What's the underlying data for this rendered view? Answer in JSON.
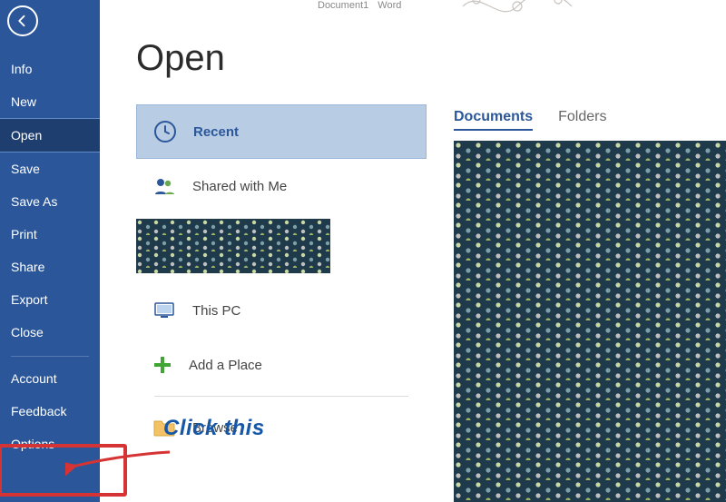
{
  "sidebar": {
    "items": [
      {
        "label": "Info"
      },
      {
        "label": "New"
      },
      {
        "label": "Open"
      },
      {
        "label": "Save"
      },
      {
        "label": "Save As"
      },
      {
        "label": "Print"
      },
      {
        "label": "Share"
      },
      {
        "label": "Export"
      },
      {
        "label": "Close"
      }
    ],
    "footer": [
      {
        "label": "Account"
      },
      {
        "label": "Feedback"
      },
      {
        "label": "Options"
      }
    ]
  },
  "page": {
    "title": "Open"
  },
  "topbar": {
    "left": "Document1",
    "mid": "Word"
  },
  "locations": {
    "items": [
      {
        "icon": "clock-icon",
        "label": "Recent",
        "active": true
      },
      {
        "icon": "people-icon",
        "label": "Shared with Me"
      },
      {
        "icon": "thispc-icon",
        "label": "This PC"
      },
      {
        "icon": "add-icon",
        "label": "Add a Place"
      },
      {
        "icon": "folder-icon",
        "label": "Browse"
      }
    ]
  },
  "tabs": {
    "items": [
      "Documents",
      "Folders"
    ]
  },
  "annotation": {
    "text": "Click this"
  },
  "colors": {
    "accent": "#2b579a",
    "selected": "#b8cce4",
    "red": "#d63434"
  }
}
